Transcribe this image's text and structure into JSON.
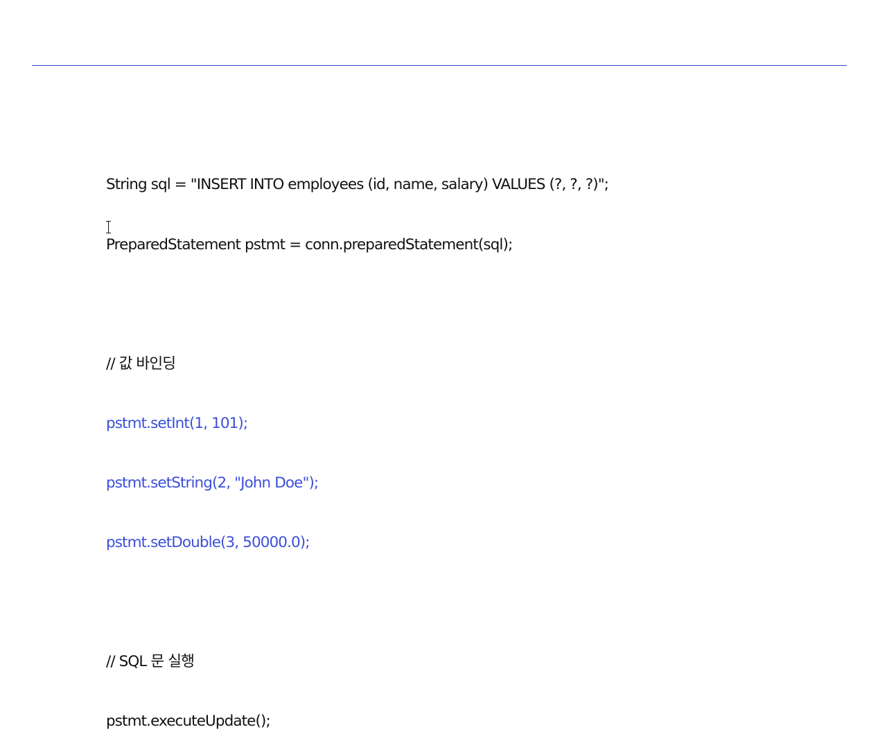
{
  "code": {
    "lines": [
      {
        "text": "String sql = \"INSERT INTO employees (id, name, salary) VALUES (?, ?, ?)\";",
        "kind": "normal"
      },
      {
        "text": "PreparedStatement pstmt = conn.preparedStatement(sql);",
        "kind": "normal"
      },
      {
        "text": "",
        "kind": "blank"
      },
      {
        "text": "// 값 바인딩",
        "kind": "comment"
      },
      {
        "text": "pstmt.setInt(1, 101);",
        "kind": "highlight"
      },
      {
        "text": "pstmt.setString(2, \"John Doe\");",
        "kind": "highlight"
      },
      {
        "text": "pstmt.setDouble(3, 50000.0);",
        "kind": "highlight"
      },
      {
        "text": "",
        "kind": "blank"
      },
      {
        "text": "// SQL 문 실행",
        "kind": "comment"
      },
      {
        "text": "pstmt.executeUpdate();",
        "kind": "normal"
      }
    ]
  },
  "colors": {
    "divider": "#2f49c9",
    "highlight": "#3b4fd8",
    "text": "#111111"
  },
  "icons": {
    "cursor": "text-cursor-icon"
  }
}
